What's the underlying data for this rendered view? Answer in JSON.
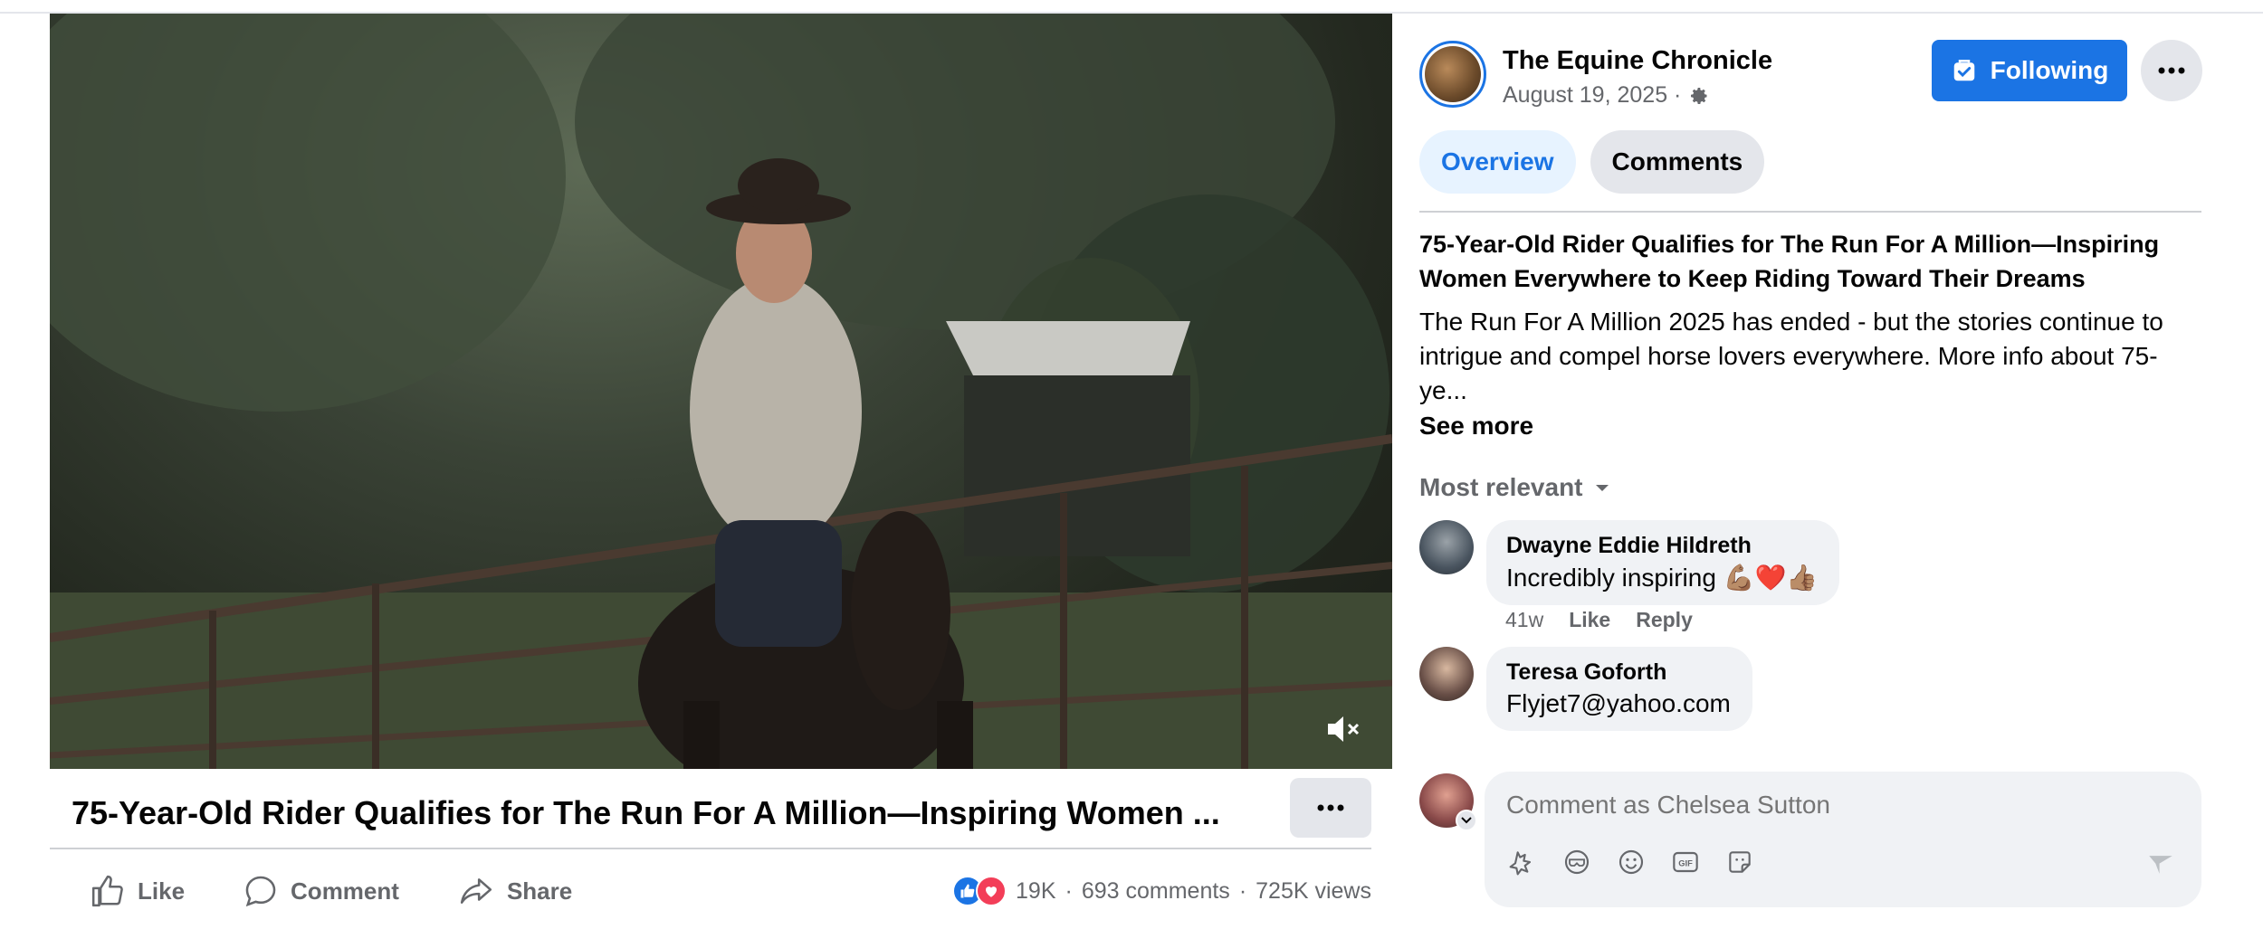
{
  "video": {
    "title": "75-Year-Old Rider Qualifies for The Run For A Million—Inspiring Women ...",
    "mute_icon": "muted-speaker-icon"
  },
  "actions": {
    "like_label": "Like",
    "comment_label": "Comment",
    "share_label": "Share"
  },
  "stats": {
    "reactions": "19K",
    "comments": "693 comments",
    "views": "725K views",
    "separator": "·"
  },
  "page": {
    "name": "The Equine Chronicle",
    "date": "August 19, 2025 ·",
    "follow_label": "Following",
    "accent": "#1b74e4"
  },
  "tabs": [
    {
      "label": "Overview",
      "active": true
    },
    {
      "label": "Comments",
      "active": false
    }
  ],
  "post": {
    "headline": "75-Year-Old Rider Qualifies for The Run For A Million—Inspiring Women Everywhere to Keep Riding Toward Their Dreams",
    "body": "The Run For A Million 2025 has ended - but the stories continue to intrigue and compel horse lovers everywhere. More info about 75-ye...",
    "see_more": "See more"
  },
  "comments_section": {
    "sort_label": "Most relevant",
    "comments": [
      {
        "name": "Dwayne Eddie Hildreth",
        "text": "Incredibly inspiring 💪🏽❤️👍🏽",
        "age": "41w",
        "like": "Like",
        "reply": "Reply"
      },
      {
        "name": "Teresa Goforth",
        "text": "Flyjet7@yahoo.com"
      }
    ]
  },
  "composer": {
    "placeholder": "Comment as Chelsea Sutton",
    "icons": [
      "avatar-sticker-icon",
      "mask-icon",
      "emoji-icon",
      "gif-icon",
      "sticker-icon"
    ]
  }
}
